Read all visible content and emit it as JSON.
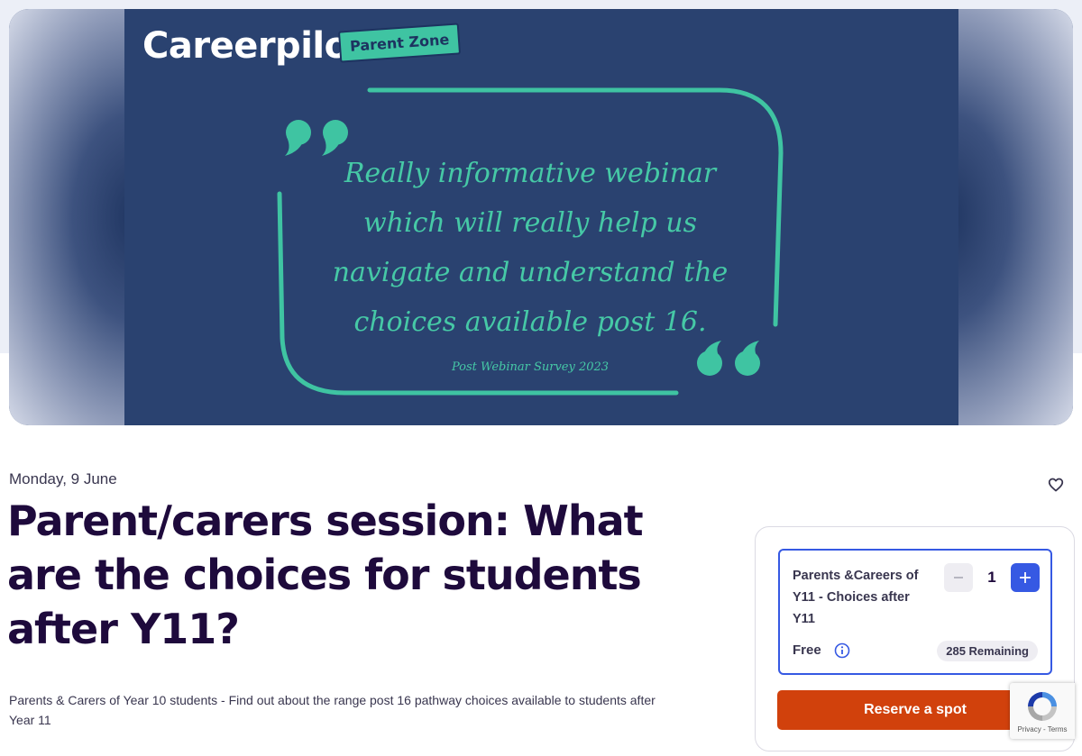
{
  "hero": {
    "brand": "Careerpilot",
    "brand_tag": "Parent Zone",
    "quote": "Really informative webinar which will really help us navigate and understand the choices available post 16.",
    "quote_source": "Post Webinar Survey 2023"
  },
  "event": {
    "date": "Monday, 9 June",
    "title": "Parent/carers session: What are the choices for students after Y11?",
    "summary": "Parents & Carers of Year 10 students - Find out about the range post 16 pathway choices available to students after Year 11"
  },
  "ticket": {
    "name": "Parents &Careers of Y11 - Choices after Y11",
    "quantity": "1",
    "price": "Free",
    "remaining": "285 Remaining",
    "reserve_label": "Reserve a spot"
  },
  "recaptcha": {
    "links": "Privacy - Terms"
  },
  "colors": {
    "brand_accent": "#3fc4a2",
    "banner_bg": "#2a4270",
    "cta": "#d1410c",
    "stepper_active": "#3659e3",
    "title_text": "#1e0a3c"
  },
  "icons": {
    "like": "heart-icon",
    "info": "info-icon",
    "minus": "minus-icon",
    "plus": "plus-icon",
    "quote_open": "quote-open-icon",
    "quote_close": "quote-close-icon"
  }
}
